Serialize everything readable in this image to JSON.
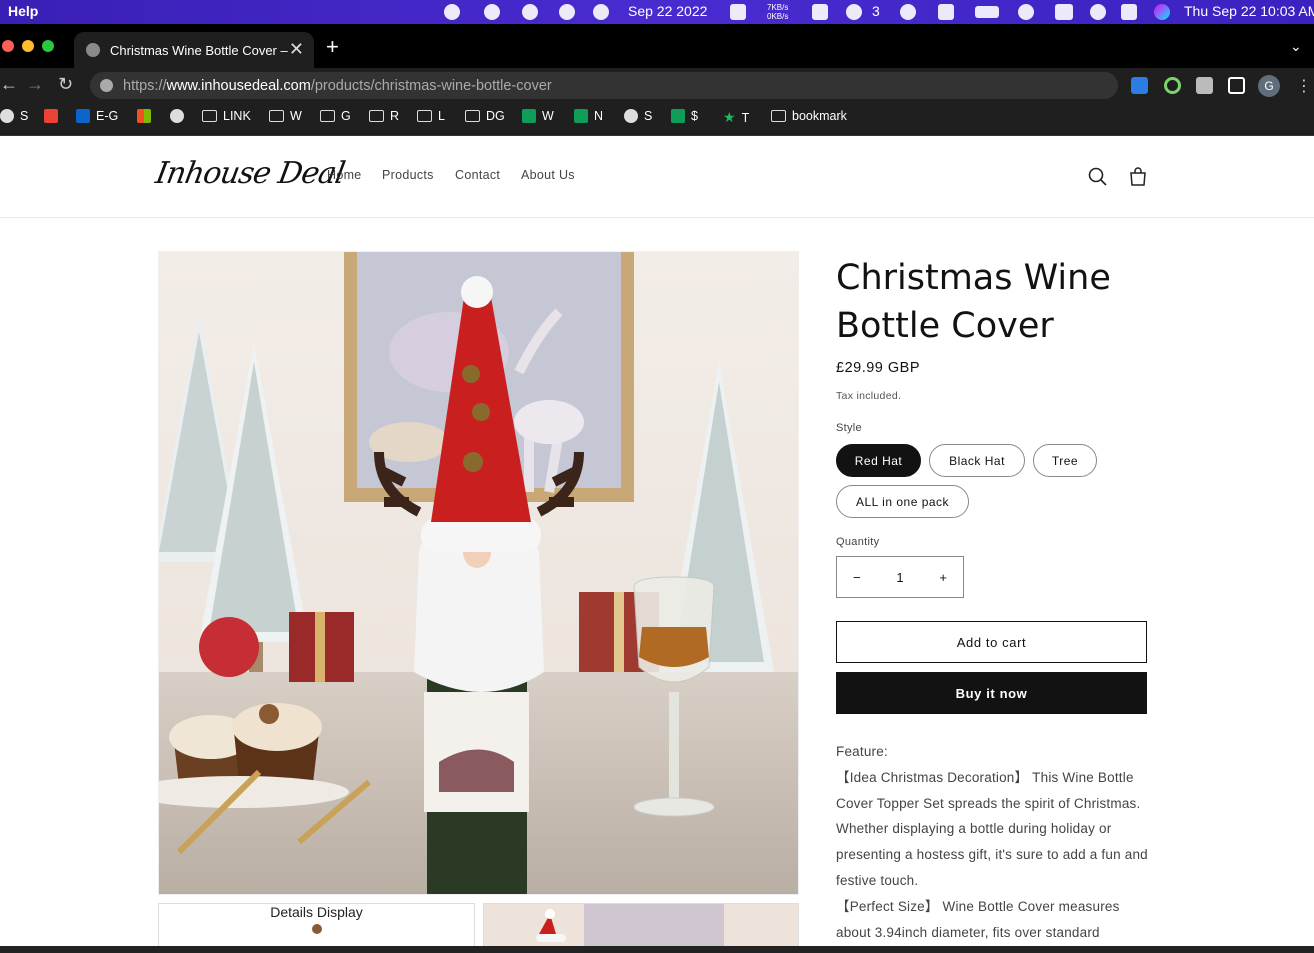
{
  "menubar": {
    "app_menu": "Help",
    "date_short": "Sep 22 2022",
    "net_up": "7KB/s",
    "net_down": "0KB/s",
    "wechat_count": "3",
    "clock": "Thu Sep 22  10:03 AM"
  },
  "browser": {
    "tab_title": "Christmas Wine Bottle Cover –",
    "new_tab": "+",
    "url_scheme": "https://",
    "url_host": "www.inhousedeal.com",
    "url_path": "/products/christmas-wine-bottle-cover",
    "profile_initial": "G",
    "bookmarks": [
      {
        "label": "S",
        "icon": "globe-icon"
      },
      {
        "label": "",
        "icon": "gmail-icon"
      },
      {
        "label": "E-G",
        "icon": "outlook-icon"
      },
      {
        "label": "",
        "icon": "microsoft-icon"
      },
      {
        "label": "",
        "icon": "globe-icon"
      },
      {
        "label": "LINK",
        "icon": "folder-icon"
      },
      {
        "label": "W",
        "icon": "folder-icon"
      },
      {
        "label": "G",
        "icon": "folder-icon"
      },
      {
        "label": "R",
        "icon": "folder-icon"
      },
      {
        "label": "L",
        "icon": "folder-icon"
      },
      {
        "label": "DG",
        "icon": "folder-icon"
      },
      {
        "label": "W",
        "icon": "sheets-icon"
      },
      {
        "label": "N",
        "icon": "sheets-icon"
      },
      {
        "label": "S",
        "icon": "globe-icon"
      },
      {
        "label": "$",
        "icon": "sheets-icon"
      },
      {
        "label": "T",
        "icon": "star-icon"
      },
      {
        "label": "bookmark",
        "icon": "folder-icon"
      }
    ]
  },
  "site": {
    "logo_text": "Inhouse Deal",
    "nav": [
      "Home",
      "Products",
      "Contact",
      "About Us"
    ]
  },
  "product": {
    "title": "Christmas Wine Bottle Cover",
    "price": "£29.99 GBP",
    "tax_note": "Tax included.",
    "style_label": "Style",
    "styles": [
      "Red Hat",
      "Black Hat",
      "Tree",
      "ALL in one pack"
    ],
    "selected_style": "Red Hat",
    "quantity_label": "Quantity",
    "quantity": "1",
    "minus": "−",
    "plus": "+",
    "add_to_cart": "Add to cart",
    "buy_now": "Buy it now",
    "thumb_caption": "Details Display",
    "description": [
      "Feature:",
      "【Idea Christmas Decoration】 This Wine Bottle Cover Topper Set spreads the spirit of Christmas. Whether displaying a bottle during holiday or presenting a hostess gift, it's sure to add a fun and festive touch.",
      "【Perfect Size】 Wine Bottle Cover measures about 3.94inch diameter, fits over standard"
    ]
  },
  "colors": {
    "menubar": "#3a1fb5",
    "browser_dark": "#1f1f1f",
    "accent_dark": "#121212"
  }
}
